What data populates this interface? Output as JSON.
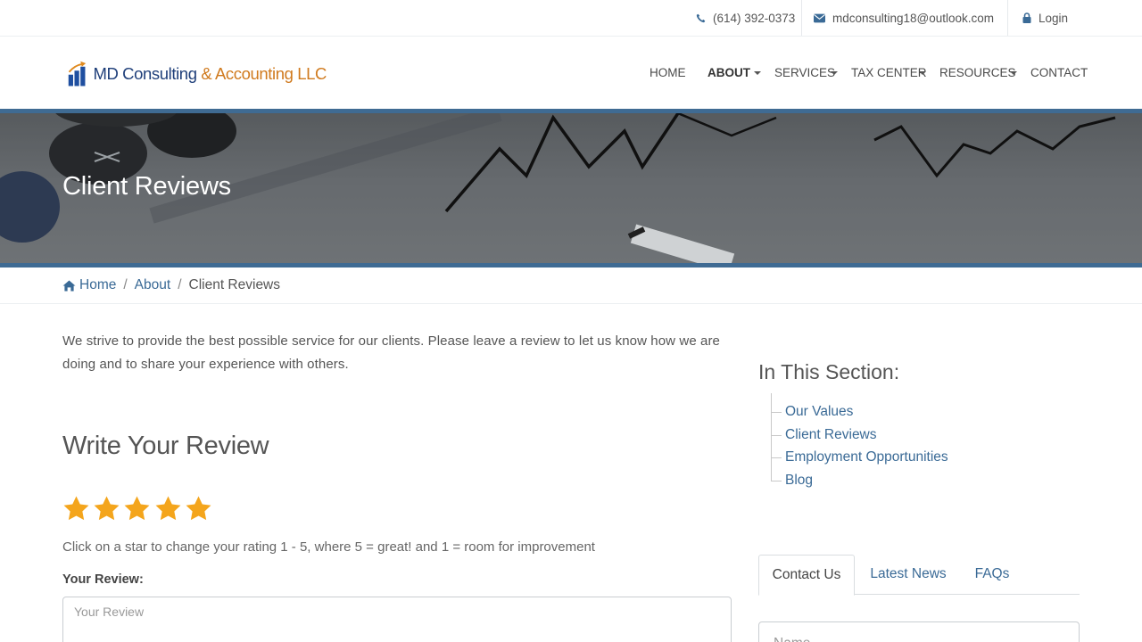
{
  "topbar": {
    "phone": "(614) 392-0373",
    "email": "mdconsulting18@outlook.com",
    "login": "Login"
  },
  "logo": {
    "part1": "MD Consulting ",
    "part2": "& Accounting LLC"
  },
  "nav": {
    "home": "HOME",
    "about": "ABOUT",
    "services": "SERVICES",
    "tax_center": "TAX CENTER",
    "resources": "RESOURCES",
    "contact": "CONTACT"
  },
  "hero": {
    "title": "Client Reviews"
  },
  "breadcrumb": {
    "home": "Home",
    "about": "About",
    "current": "Client Reviews"
  },
  "main": {
    "intro": "We strive to provide the best possible service for our clients. Please leave a review to let us know how we are doing and to share your experience with others.",
    "write_title": "Write Your Review",
    "rating": 5,
    "rating_help": "Click on a star to change your rating 1 - 5, where 5 = great! and 1 = room for improvement",
    "review_label": "Your Review:",
    "review_placeholder": "Your Review"
  },
  "sidebar": {
    "title": "In This Section:",
    "items": [
      {
        "label": "Our Values"
      },
      {
        "label": "Client Reviews"
      },
      {
        "label": "Employment Opportunities"
      },
      {
        "label": "Blog"
      }
    ],
    "tabs": [
      {
        "label": "Contact Us"
      },
      {
        "label": "Latest News"
      },
      {
        "label": "FAQs"
      }
    ],
    "name_placeholder": "Name"
  },
  "colors": {
    "link": "#3a6a96",
    "star": "#f4a51c",
    "hero_border": "#3f6b93",
    "logo_blue": "#1f3f7a",
    "logo_orange": "#d07a1e"
  }
}
